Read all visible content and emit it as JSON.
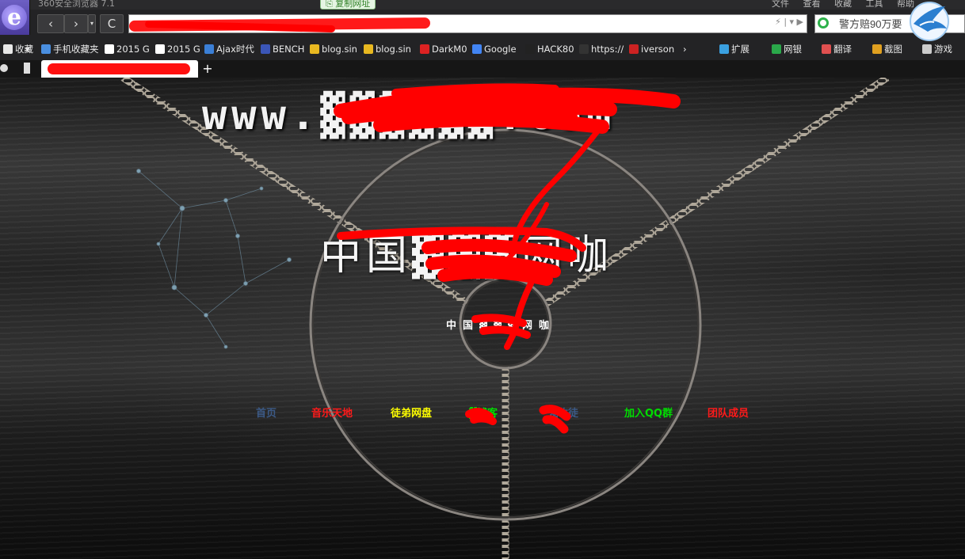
{
  "browser": {
    "window_title": "360安全浏览器 7.1",
    "copy_url_tooltip": "复制网址",
    "top_menus": [
      "文件",
      "查看",
      "收藏",
      "工具",
      "帮助"
    ],
    "nav": {
      "back": "‹",
      "forward": "›",
      "history": "▾",
      "reload": "C"
    },
    "address_icons": "⚡ | ▾ ▶",
    "search": {
      "placeholder": "警方赔90万要",
      "engine_icon": "search-engine-icon"
    },
    "bookmarks": [
      {
        "label": "收藏",
        "icon": "favorites-icon",
        "color": "#e8e8e8"
      },
      {
        "label": "▾",
        "icon": "",
        "color": "#e8e8e8"
      },
      {
        "label": "手机收藏夹",
        "icon": "mobile-icon",
        "color": "#4a8fe0"
      },
      {
        "label": "2015 G",
        "icon": "site-l-icon",
        "color": "#ffffff"
      },
      {
        "label": "2015 G",
        "icon": "site-l-icon",
        "color": "#ffffff"
      },
      {
        "label": "Ajax时代",
        "icon": "ajax-icon",
        "color": "#3b7fd6"
      },
      {
        "label": "BENCH",
        "icon": "bench-icon",
        "color": "#3b56b8"
      },
      {
        "label": "blog.sin",
        "icon": "blog-icon",
        "color": "#e8b820"
      },
      {
        "label": "blog.sin",
        "icon": "blog-icon",
        "color": "#e8b820"
      },
      {
        "label": "DarkM0",
        "icon": "darkm0-icon",
        "color": "#d22"
      },
      {
        "label": "Google",
        "icon": "google-icon",
        "color": "#4285f4"
      },
      {
        "label": "HACK80",
        "icon": "hack80-icon",
        "color": "#222"
      },
      {
        "label": "https://",
        "icon": "github-icon",
        "color": "#333"
      },
      {
        "label": "iverson",
        "icon": "slc-icon",
        "color": "#c22"
      },
      {
        "label": "›",
        "icon": "",
        "color": "#e8e8e8"
      },
      {
        "label": "扩展",
        "icon": "extensions-icon",
        "color": "#3aa0e0"
      },
      {
        "label": "网银",
        "icon": "bank-icon",
        "color": "#2aa84a"
      },
      {
        "label": "翻译",
        "icon": "translate-icon",
        "color": "#e05050"
      },
      {
        "label": "截图",
        "icon": "screenshot-icon",
        "color": "#e0a020"
      },
      {
        "label": "游戏",
        "icon": "game-icon",
        "color": "#cccccc"
      }
    ],
    "tabs": {
      "new_tab": "+"
    }
  },
  "site": {
    "domain": "www.▓▓▓▓▓▓.com",
    "title": "中国▓▓▓网咖",
    "subtitle": "中国▓▓▓网咖",
    "nav": [
      {
        "label": "首页",
        "color": "#3c5a86"
      },
      {
        "label": "音乐天地",
        "color": "#ff1a1a"
      },
      {
        "label": "徒弟网盘",
        "color": "#ffff00"
      },
      {
        "label": "▓博客",
        "color": "#00dd00"
      },
      {
        "label": "▓收徒",
        "color": "#3c5a86"
      },
      {
        "label": "加入QQ群",
        "color": "#00dd00"
      },
      {
        "label": "团队成员",
        "color": "#ff1a1a"
      }
    ]
  },
  "colors": {
    "redaction": "#ff0000",
    "chrome_bg": "#232325",
    "page_bg": "#262626"
  }
}
